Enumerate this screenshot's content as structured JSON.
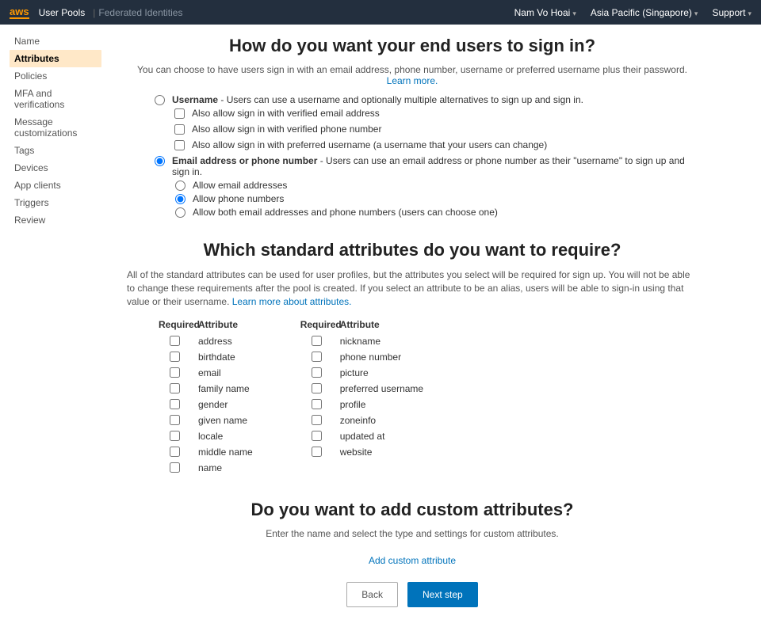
{
  "topnav": {
    "logo": "aws",
    "service_active": "User Pools",
    "service_inactive": "Federated Identities",
    "user": "Nam Vo Hoai",
    "region": "Asia Pacific (Singapore)",
    "support": "Support"
  },
  "sidebar": {
    "items": [
      {
        "label": "Name"
      },
      {
        "label": "Attributes"
      },
      {
        "label": "Policies"
      },
      {
        "label": "MFA and verifications"
      },
      {
        "label": "Message customizations"
      },
      {
        "label": "Tags"
      },
      {
        "label": "Devices"
      },
      {
        "label": "App clients"
      },
      {
        "label": "Triggers"
      },
      {
        "label": "Review"
      }
    ],
    "selected_index": 1
  },
  "signin": {
    "heading": "How do you want your end users to sign in?",
    "intro": "You can choose to have users sign in with an email address, phone number, username or preferred username plus their password. ",
    "learn_more": "Learn more.",
    "opt1_label": "Username",
    "opt1_desc": " - Users can use a username and optionally multiple alternatives to sign up and sign in.",
    "opt1_subs": [
      "Also allow sign in with verified email address",
      "Also allow sign in with verified phone number",
      "Also allow sign in with preferred username (a username that your users can change)"
    ],
    "opt2_label": "Email address or phone number",
    "opt2_desc": " - Users can use an email address or phone number as their \"username\" to sign up and sign in.",
    "opt2_subs": [
      "Allow email addresses",
      "Allow phone numbers",
      "Allow both email addresses and phone numbers (users can choose one)"
    ],
    "opt2_selected_sub": 1
  },
  "attrs": {
    "heading": "Which standard attributes do you want to require?",
    "intro_a": "All of the standard attributes can be used for user profiles, but the attributes you select will be required for sign up. You will not be able to change these requirements after the pool is created. If you select an attribute to be an alias, users will be able to sign-in using that value or their username. ",
    "intro_link": "Learn more about attributes.",
    "header_required": "Required",
    "header_attribute": "Attribute",
    "col1": [
      "address",
      "birthdate",
      "email",
      "family name",
      "gender",
      "given name",
      "locale",
      "middle name",
      "name"
    ],
    "col2": [
      "nickname",
      "phone number",
      "picture",
      "preferred username",
      "profile",
      "zoneinfo",
      "updated at",
      "website"
    ]
  },
  "custom": {
    "heading": "Do you want to add custom attributes?",
    "intro": "Enter the name and select the type and settings for custom attributes.",
    "add_link": "Add custom attribute"
  },
  "buttons": {
    "back": "Back",
    "next": "Next step"
  }
}
